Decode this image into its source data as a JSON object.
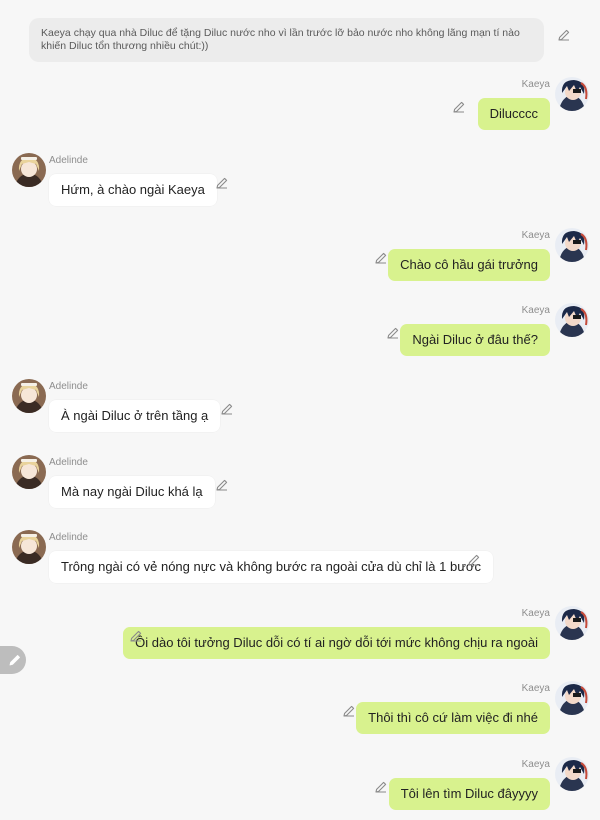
{
  "narration": "Kaeya chạy qua nhà Diluc để tặng Diluc nước nho vì lần trước lỡ bảo nước nho không lãng mạn tí nào khiến Diluc tổn thương nhiều chút:))",
  "colors": {
    "background": "#f7f7f7",
    "sent_bubble": "#d8f28e",
    "received_bubble": "#ffffff",
    "name_text": "#8e8e8e"
  },
  "icons": {
    "edit": "pencil-icon",
    "fab": "pencil-icon"
  },
  "messages": [
    {
      "sender": "Kaeya",
      "side": "right",
      "text": "Dilucccc"
    },
    {
      "sender": "Adelinde",
      "side": "left",
      "text": "Hứm, à chào ngài Kaeya"
    },
    {
      "sender": "Kaeya",
      "side": "right",
      "text": "Chào cô hầu gái trưởng"
    },
    {
      "sender": "Kaeya",
      "side": "right",
      "text": "Ngài Diluc ở đâu thế?"
    },
    {
      "sender": "Adelinde",
      "side": "left",
      "text": "À ngài Diluc ở trên tầng ạ"
    },
    {
      "sender": "Adelinde",
      "side": "left",
      "text": "Mà nay ngài Diluc khá lạ"
    },
    {
      "sender": "Adelinde",
      "side": "left",
      "text": "Trông ngài có vẻ nóng nực và không bước ra ngoài cửa dù chỉ là 1 bước"
    },
    {
      "sender": "Kaeya",
      "side": "right",
      "text": "Ôi dào tôi tưởng Diluc dỗi có tí ai ngờ dỗi tới mức không chịu ra ngoài"
    },
    {
      "sender": "Kaeya",
      "side": "right",
      "text": "Thôi thì cô cứ làm việc đi nhé"
    },
    {
      "sender": "Kaeya",
      "side": "right",
      "text": "Tôi lên tìm Diluc đâyyyy"
    }
  ]
}
